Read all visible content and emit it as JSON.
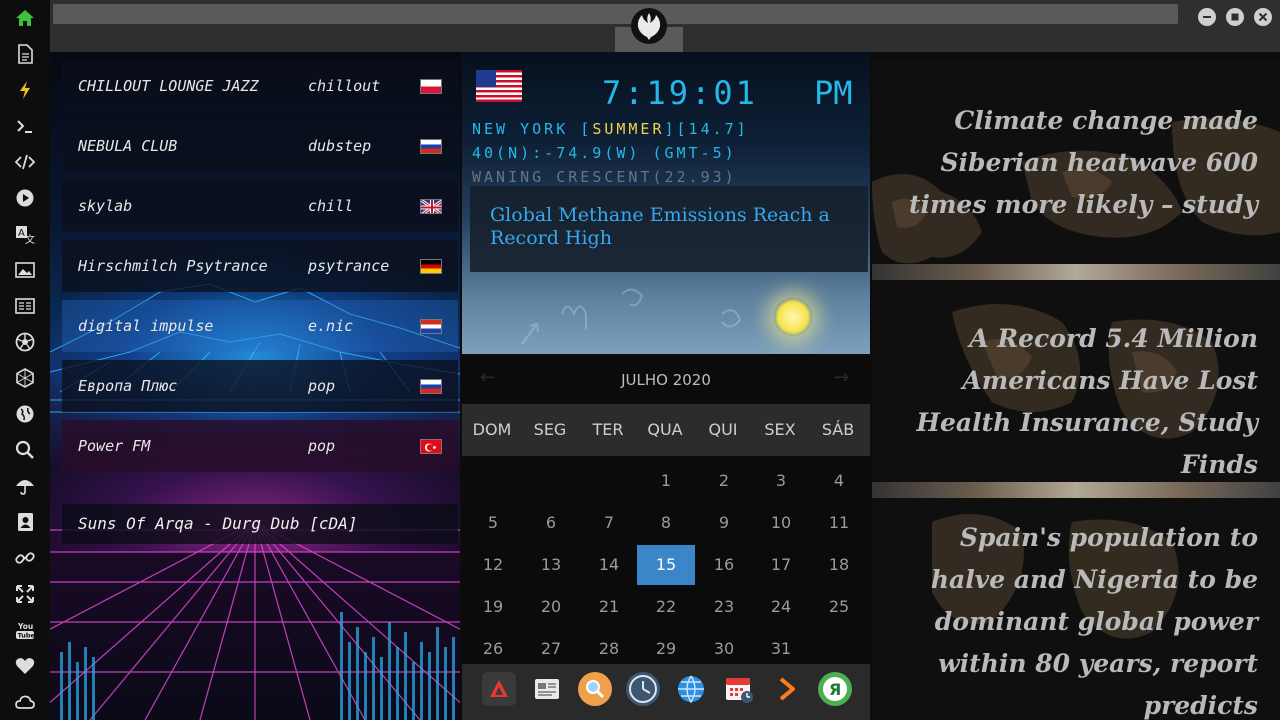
{
  "sidebar": {
    "items": [
      {
        "name": "home-icon",
        "color": "#3fbf3f"
      },
      {
        "name": "document-icon"
      },
      {
        "name": "lightning-icon",
        "color": "#f0c419"
      },
      {
        "name": "terminal-icon"
      },
      {
        "name": "code-icon"
      },
      {
        "name": "play-icon"
      },
      {
        "name": "translate-icon"
      },
      {
        "name": "image-icon"
      },
      {
        "name": "news-icon"
      },
      {
        "name": "aperture-icon"
      },
      {
        "name": "hexagon-icon"
      },
      {
        "name": "globe-icon"
      },
      {
        "name": "search-icon"
      },
      {
        "name": "umbrella-icon"
      },
      {
        "name": "contacts-icon"
      },
      {
        "name": "link-icon"
      },
      {
        "name": "fullscreen-icon"
      },
      {
        "name": "youtube-icon",
        "label": "You Tube"
      },
      {
        "name": "heart-icon"
      },
      {
        "name": "cloud-icon"
      }
    ]
  },
  "topbar": {
    "emblem": "rebel-alliance-icon",
    "window_controls": [
      "minimize-icon",
      "maximize-icon",
      "close-icon"
    ]
  },
  "radio": {
    "stations": [
      {
        "name": "CHILLOUT LOUNGE JAZZ",
        "genre": "chillout",
        "flag": "poland"
      },
      {
        "name": "NEBULA CLUB",
        "genre": "dubstep",
        "flag": "russia"
      },
      {
        "name": "skylab",
        "genre": "chill",
        "flag": "uk"
      },
      {
        "name": "Hirschmilch Psytrance",
        "genre": "psytrance",
        "flag": "germany"
      },
      {
        "name": "digital impulse",
        "genre": "e.nic",
        "flag": "croatia"
      },
      {
        "name": "Европа Плюс",
        "genre": "pop",
        "flag": "russia"
      },
      {
        "name": "Power FM",
        "genre": "pop",
        "flag": "turkey"
      }
    ],
    "now_playing": "Suns Of Arqa - Durg Dub [cDA]"
  },
  "clock": {
    "time": "7:19:01",
    "ampm": "PM",
    "flag": "usa",
    "location_line": {
      "prefix": "NEW YORK [",
      "season": "SUMMER",
      "suffix": "][14.7]"
    },
    "coords": "40(N):-74.9(W) (GMT-5)",
    "moon": "WANING CRESCENT(22.93)",
    "headline": "Global Methane Emissions Reach a Record High"
  },
  "calendar": {
    "month": "JULHO 2020",
    "prev": "←",
    "next": "→",
    "weekdays": [
      "DOM",
      "SEG",
      "TER",
      "QUA",
      "QUI",
      "SEX",
      "SÁB"
    ],
    "today": 15,
    "days": [
      [
        "",
        "",
        "",
        "1",
        "2",
        "3",
        "4"
      ],
      [
        "5",
        "6",
        "7",
        "8",
        "9",
        "10",
        "11"
      ],
      [
        "12",
        "13",
        "14",
        "15",
        "16",
        "17",
        "18"
      ],
      [
        "19",
        "20",
        "21",
        "22",
        "23",
        "24",
        "25"
      ],
      [
        "26",
        "27",
        "28",
        "29",
        "30",
        "31",
        ""
      ]
    ]
  },
  "dock": {
    "apps": [
      {
        "name": "app-launcher-icon",
        "color": "#3a3a3a"
      },
      {
        "name": "newspaper-icon",
        "color": "#e9e9e9"
      },
      {
        "name": "search-app-icon",
        "color": "#f0a04b"
      },
      {
        "name": "clock-app-icon",
        "color": "#3d5770"
      },
      {
        "name": "web-globe-icon",
        "color": "#2d8fe0"
      },
      {
        "name": "calendar-app-icon",
        "color": "#e53935"
      },
      {
        "name": "forward-arrow-icon",
        "color": "#ff7a1a"
      },
      {
        "name": "yandex-icon",
        "color": "#4caf50"
      }
    ]
  },
  "news": {
    "headlines": [
      "Climate change made Siberian heatwave 600 times more likely – study",
      "A Record 5.4 Million Americans Have Lost Health Insurance, Study Finds",
      "Spain's population to halve and Nigeria to be dominant global power within 80 years, report predicts"
    ]
  }
}
